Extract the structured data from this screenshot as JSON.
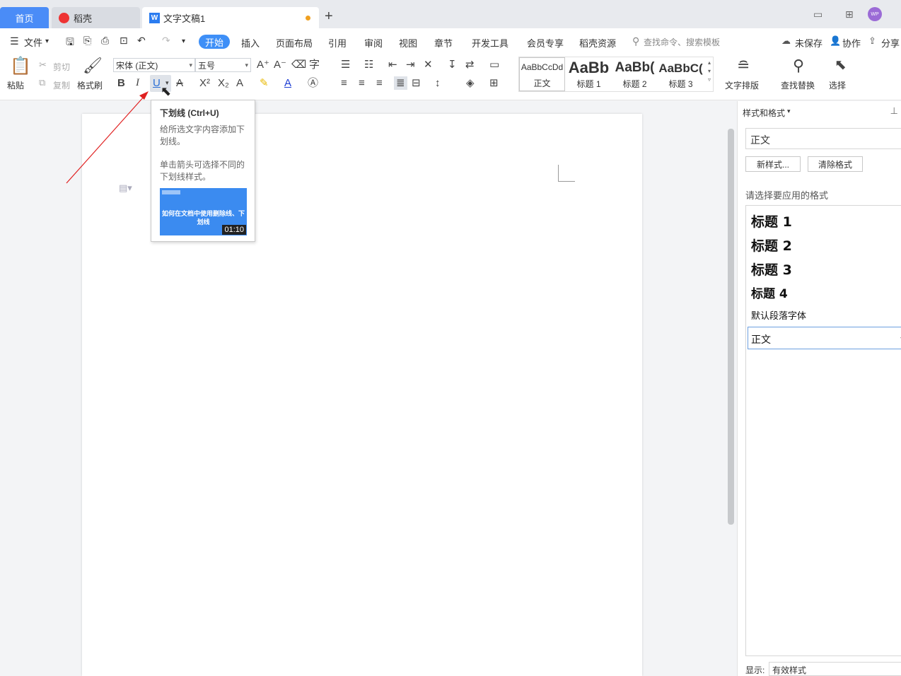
{
  "tabs": {
    "home": "首页",
    "daoke": "稻壳",
    "doc": "文字文稿1",
    "plus": "+"
  },
  "window": {
    "avatar_text": "WP"
  },
  "menu": {
    "file": "文件",
    "items": [
      "开始",
      "插入",
      "页面布局",
      "引用",
      "审阅",
      "视图",
      "章节",
      "开发工具",
      "会员专享",
      "稻壳资源"
    ],
    "search_placeholder": "查找命令、搜索模板",
    "unsaved": "未保存",
    "collaborate": "协作",
    "share": "分享"
  },
  "ribbon": {
    "paste": "粘贴",
    "cut": "剪切",
    "copy": "复制",
    "format_painter": "格式刷",
    "font_name": "宋体 (正文)",
    "font_size": "五号",
    "styles": [
      {
        "preview": "AaBbCcDd",
        "label": "正文"
      },
      {
        "preview": "AaBb",
        "label": "标题 1"
      },
      {
        "preview": "AaBb(",
        "label": "标题 2"
      },
      {
        "preview": "AaBbC(",
        "label": "标题 3"
      }
    ],
    "text_layout": "文字排版",
    "find_replace": "查找替换",
    "select": "选择"
  },
  "tooltip": {
    "title": "下划线 (Ctrl+U)",
    "line1": "给所选文字内容添加下划线。",
    "line2": "单击箭头可选择不同的下划线样式。",
    "video_title": "如何在文档中使用删除线、下划线",
    "video_duration": "01:10"
  },
  "pane": {
    "title": "样式和格式",
    "current_style": "正文",
    "new_style": "新样式...",
    "clear_format": "清除格式",
    "apply_label": "请选择要应用的格式",
    "styles": [
      "标题  1",
      "标题  2",
      "标题  3",
      "标题  4",
      "默认段落字体",
      "正文"
    ],
    "show_label": "显示:",
    "show_value": "有效样式"
  }
}
